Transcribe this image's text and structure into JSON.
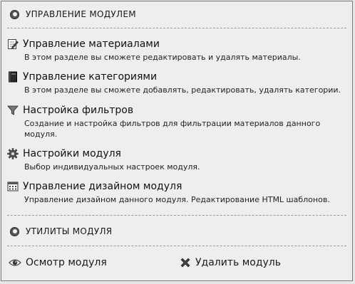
{
  "module_section": {
    "title": "УПРАВЛЕНИЕ МОДУЛЕМ"
  },
  "items": [
    {
      "title": "Управление материалами",
      "description": "В этом разделе вы сможете редактировать и удалять материалы.",
      "icon": "edit-document-icon"
    },
    {
      "title": "Управление категориями",
      "description": "В этом разделе вы сможете добавлять, редактировать, удалять категории.",
      "icon": "book-icon"
    },
    {
      "title": "Настройка фильтров",
      "description": "Создание и настройка фильтров для фильтрации материалов данного модуля.",
      "icon": "filter-icon"
    },
    {
      "title": "Настройки модуля",
      "description": "Выбор индивидуальных настроек модуля.",
      "icon": "gear-icon"
    },
    {
      "title": "Управление дизайном модуля",
      "description": "Управление дизайном данного модуля. Редактирование HTML шаблонов.",
      "icon": "layout-grid-icon"
    }
  ],
  "utilities_section": {
    "title": "УТИЛИТЫ МОДУЛЯ"
  },
  "utilities": {
    "view": {
      "label": "Осмотр модуля",
      "icon": "eye-icon"
    },
    "delete": {
      "label": "Удалить модуль",
      "icon": "close-icon"
    }
  }
}
